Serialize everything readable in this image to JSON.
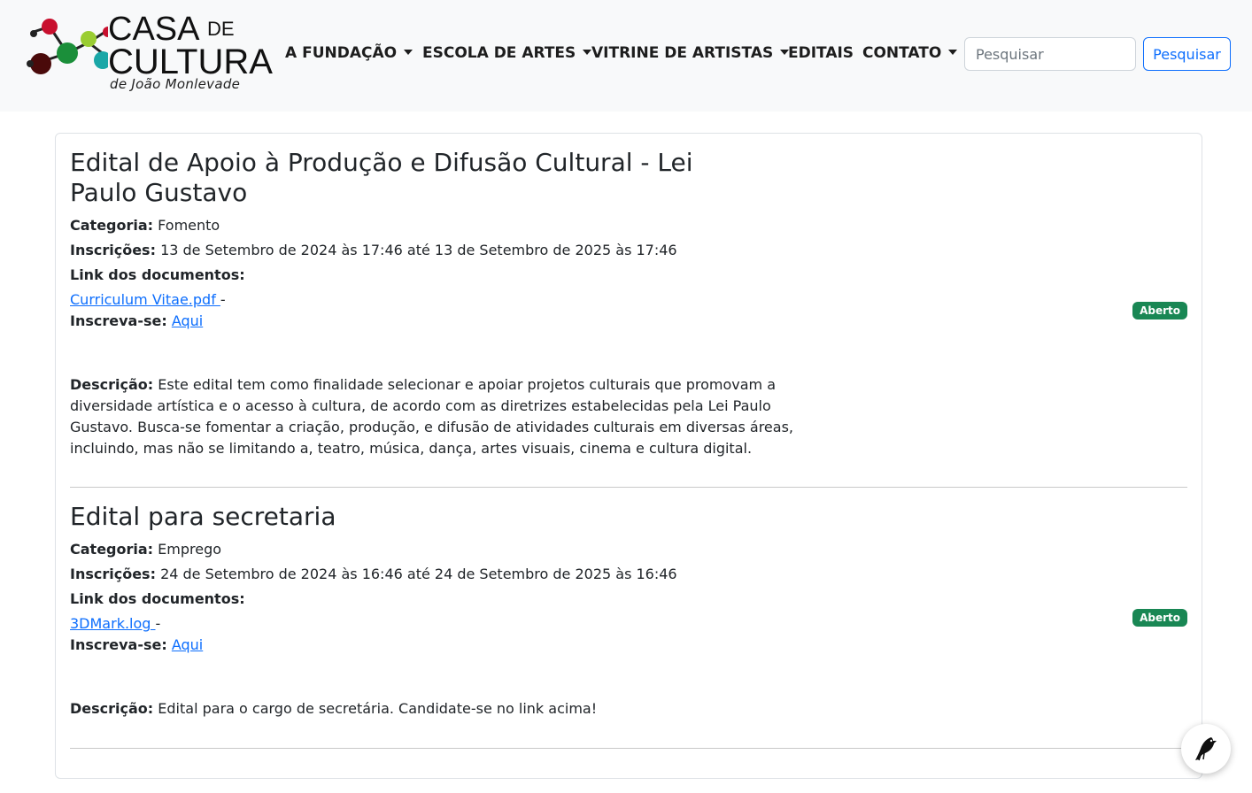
{
  "brand": {
    "line1": "CASA",
    "line1_small": "DE",
    "line2": "CULTURA",
    "subtitle": "de João Monlevade",
    "colors": [
      "#c8102e",
      "#1b8f3a",
      "#9acd32",
      "#1aa7a7",
      "#8b0000",
      "#222222"
    ]
  },
  "nav": {
    "items": [
      {
        "label": "A FUNDAÇÃO",
        "dropdown": true
      },
      {
        "label": "ESCOLA DE ARTES",
        "dropdown": true
      },
      {
        "label": "VITRINE DE ARTISTAS",
        "dropdown": true
      },
      {
        "label": "EDITAIS",
        "dropdown": false
      },
      {
        "label": "CONTATO",
        "dropdown": true
      }
    ],
    "search_placeholder": "Pesquisar",
    "search_button": "Pesquisar"
  },
  "labels": {
    "categoria": "Categoria:",
    "inscricoes": "Inscrições:",
    "link_docs": "Link dos documentos:",
    "inscreva": "Inscreva-se:",
    "descricao": "Descrição:",
    "separator": "-"
  },
  "editais": [
    {
      "title": "Edital de Apoio à Produção e Difusão Cultural - Lei Paulo Gustavo",
      "categoria": "Fomento",
      "inscricoes": "13 de Setembro de 2024 às 17:46 até 13 de Setembro de 2025 às 17:46",
      "documento": "Curriculum Vitae.pdf ",
      "inscreva_link": "Aqui",
      "descricao": "Este edital tem como finalidade selecionar e apoiar projetos culturais que promovam a diversidade artística e o acesso à cultura, de acordo com as diretrizes estabelecidas pela Lei Paulo Gustavo. Busca-se fomentar a criação, produção, e difusão de atividades culturais em diversas áreas, incluindo, mas não se limitando a, teatro, música, dança, artes visuais, cinema e cultura digital.",
      "status": "Aberto"
    },
    {
      "title": "Edital para secretaria",
      "categoria": "Emprego",
      "inscricoes": "24 de Setembro de 2024 às 16:46 até 24 de Setembro de 2025 às 16:46",
      "documento": "3DMark.log ",
      "inscreva_link": "Aqui",
      "descricao": "Edital para o cargo de secretária. Candidate-se no link acima!",
      "status": "Aberto"
    }
  ],
  "colors": {
    "link": "#0d6efd",
    "badge_success": "#198754",
    "navbar_bg": "#f8f9fa"
  }
}
